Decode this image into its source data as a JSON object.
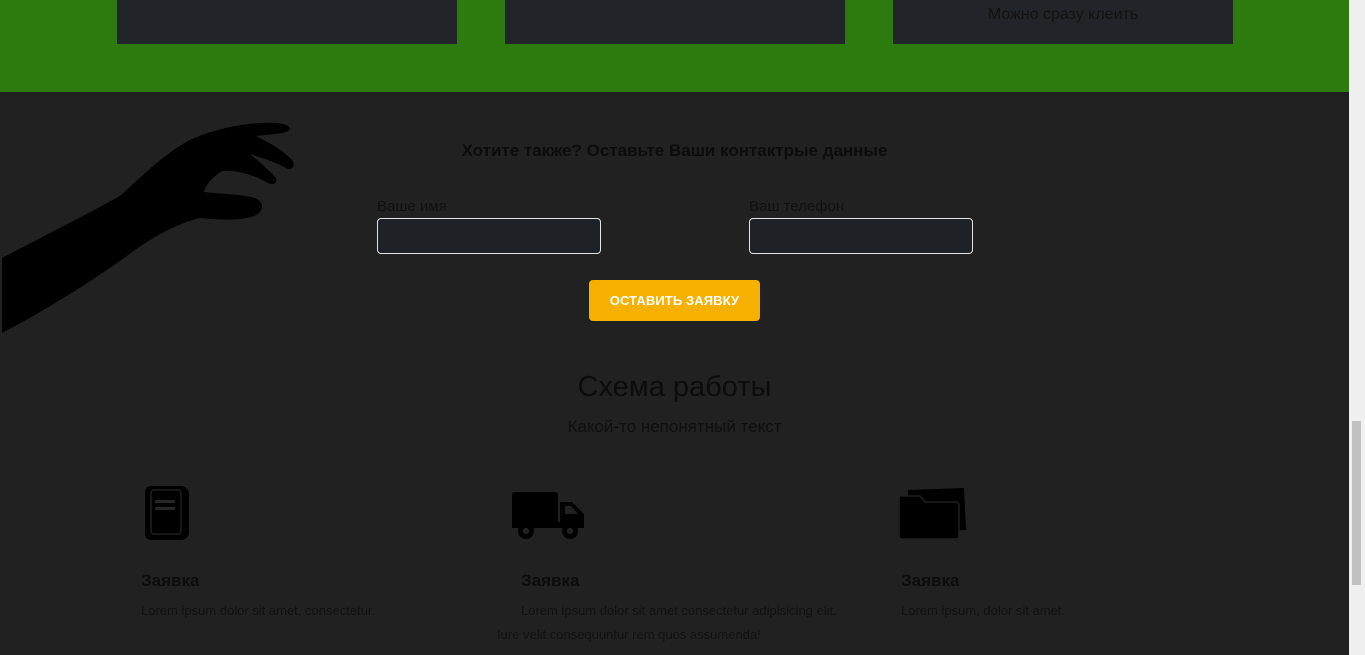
{
  "top_cards": [
    {
      "text": ""
    },
    {
      "text": ""
    },
    {
      "text": "Можно сразу клеить"
    }
  ],
  "contact_form": {
    "title": "Хотите также? Оставьте Ваши контактрые данные",
    "name_label": "Ваше имя",
    "phone_label": "Ваш телефон",
    "name_value": "",
    "phone_value": "",
    "submit_label": "ОСТАВИТЬ ЗАЯВКУ"
  },
  "scheme": {
    "title": "Схема работы",
    "subtitle": "Какой-то непонятный текст",
    "steps": [
      {
        "icon": "book-icon",
        "title": "Заявка",
        "text": "Lorem ipsum dolor sit amet, consectetur."
      },
      {
        "icon": "truck-icon",
        "title": "Заявка",
        "text": "Lorem ipsum dolor sit amet consectetur adipisicing elit. Iure velit consequuntur rem quos assumenda!"
      },
      {
        "icon": "folder-icon",
        "title": "Заявка",
        "text": "Lorem ipsum, dolor sit amet."
      }
    ]
  },
  "colors": {
    "green_band": "#2d7a0e",
    "page_background": "#212121",
    "button": "#f5b000"
  }
}
